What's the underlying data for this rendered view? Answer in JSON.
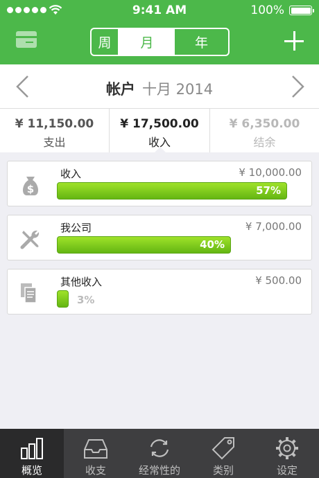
{
  "status_bar": {
    "time": "9:41 AM",
    "battery": "100%"
  },
  "header": {
    "segments": [
      "周",
      "月",
      "年"
    ],
    "selected_segment": "月"
  },
  "month_nav": {
    "account": "帐户",
    "period": "十月 2014"
  },
  "summary": [
    {
      "amount": "¥ 11,150.00",
      "label": "支出"
    },
    {
      "amount": "¥ 17,500.00",
      "label": "收入"
    },
    {
      "amount": "¥ 6,350.00",
      "label": "结余"
    }
  ],
  "categories": [
    {
      "name": "收入",
      "amount": "¥ 10,000.00",
      "percent_label": "57%",
      "percent": 57,
      "icon": "money-bag-icon"
    },
    {
      "name": "我公司",
      "amount": "¥ 7,000.00",
      "percent_label": "40%",
      "percent": 40,
      "icon": "tools-icon"
    },
    {
      "name": "其他收入",
      "amount": "¥ 500.00",
      "percent_label": "3%",
      "percent": 3,
      "icon": "documents-icon"
    }
  ],
  "tabs": [
    {
      "label": "概览",
      "icon": "chart-icon",
      "active": true
    },
    {
      "label": "收支",
      "icon": "inbox-icon",
      "active": false
    },
    {
      "label": "经常性的",
      "icon": "recurring-icon",
      "active": false
    },
    {
      "label": "类别",
      "icon": "tag-icon",
      "active": false
    },
    {
      "label": "设定",
      "icon": "gear-icon",
      "active": false
    }
  ],
  "colors": {
    "brand_green": "#4cb84a",
    "bar_green": "#7ccc1e",
    "tabbar": "#3e3e40"
  }
}
